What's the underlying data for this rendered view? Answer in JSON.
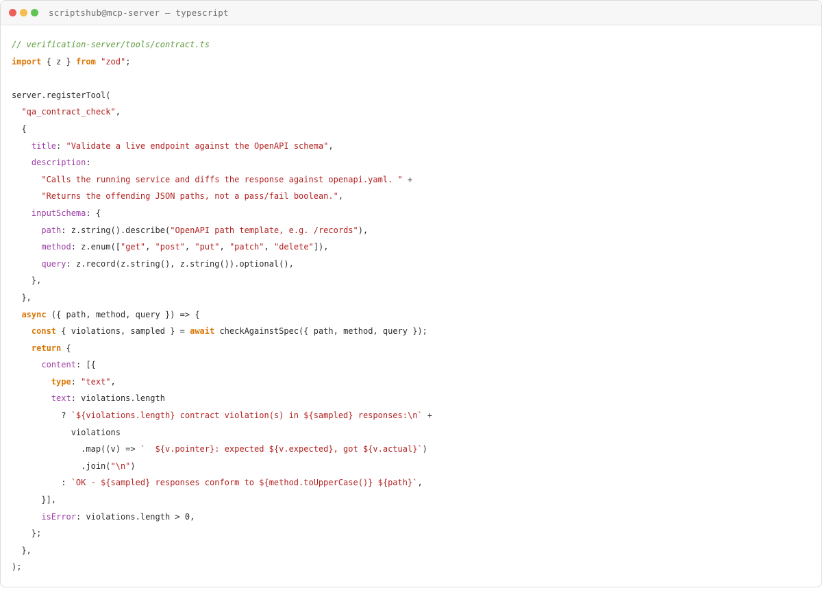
{
  "window": {
    "title": "scriptshub@mcp-server — typescript",
    "controls": [
      {
        "name": "close-button",
        "color": "#ee5f57"
      },
      {
        "name": "minimize-button",
        "color": "#f5bd4f"
      },
      {
        "name": "maximize-button",
        "color": "#5fc453"
      }
    ]
  },
  "colors": {
    "comment": "#5a9a3a",
    "keyword": "#d97706",
    "string": "#b22020",
    "property": "#9c3ea6",
    "text": "#2b2b2b"
  },
  "code_lines": [
    [
      [
        "cmt",
        "// verification-server/tools/contract.ts"
      ]
    ],
    [
      [
        "kw",
        "import"
      ],
      [
        "plain",
        " { z } "
      ],
      [
        "kw",
        "from"
      ],
      [
        "plain",
        " "
      ],
      [
        "str",
        "\"zod\""
      ],
      [
        "plain",
        ";"
      ]
    ],
    [],
    [
      [
        "plain",
        "server.registerTool("
      ]
    ],
    [
      [
        "plain",
        "  "
      ],
      [
        "str",
        "\"qa_contract_check\""
      ],
      [
        "plain",
        ","
      ]
    ],
    [
      [
        "plain",
        "  {"
      ]
    ],
    [
      [
        "plain",
        "    "
      ],
      [
        "prop",
        "title"
      ],
      [
        "plain",
        ": "
      ],
      [
        "str",
        "\"Validate a live endpoint against the OpenAPI schema\""
      ],
      [
        "plain",
        ","
      ]
    ],
    [
      [
        "plain",
        "    "
      ],
      [
        "prop",
        "description"
      ],
      [
        "plain",
        ":"
      ]
    ],
    [
      [
        "plain",
        "      "
      ],
      [
        "str",
        "\"Calls the running service and diffs the response against openapi.yaml. \""
      ],
      [
        "plain",
        " +"
      ]
    ],
    [
      [
        "plain",
        "      "
      ],
      [
        "str",
        "\"Returns the offending JSON paths, not a pass/fail boolean.\""
      ],
      [
        "plain",
        ","
      ]
    ],
    [
      [
        "plain",
        "    "
      ],
      [
        "prop",
        "inputSchema"
      ],
      [
        "plain",
        ": {"
      ]
    ],
    [
      [
        "plain",
        "      "
      ],
      [
        "prop",
        "path"
      ],
      [
        "plain",
        ": z.string().describe("
      ],
      [
        "str",
        "\"OpenAPI path template, e.g. /records\""
      ],
      [
        "plain",
        "),"
      ]
    ],
    [
      [
        "plain",
        "      "
      ],
      [
        "prop",
        "method"
      ],
      [
        "plain",
        ": z.enum(["
      ],
      [
        "str",
        "\"get\""
      ],
      [
        "plain",
        ", "
      ],
      [
        "str",
        "\"post\""
      ],
      [
        "plain",
        ", "
      ],
      [
        "str",
        "\"put\""
      ],
      [
        "plain",
        ", "
      ],
      [
        "str",
        "\"patch\""
      ],
      [
        "plain",
        ", "
      ],
      [
        "str",
        "\"delete\""
      ],
      [
        "plain",
        "]),"
      ]
    ],
    [
      [
        "plain",
        "      "
      ],
      [
        "prop",
        "query"
      ],
      [
        "plain",
        ": z.record(z.string(), z.string()).optional(),"
      ]
    ],
    [
      [
        "plain",
        "    },"
      ]
    ],
    [
      [
        "plain",
        "  },"
      ]
    ],
    [
      [
        "plain",
        "  "
      ],
      [
        "kw",
        "async"
      ],
      [
        "plain",
        " ({ path, method, query }) => {"
      ]
    ],
    [
      [
        "plain",
        "    "
      ],
      [
        "kw",
        "const"
      ],
      [
        "plain",
        " { violations, sampled } = "
      ],
      [
        "kw",
        "await"
      ],
      [
        "plain",
        " checkAgainstSpec({ path, method, query });"
      ]
    ],
    [
      [
        "plain",
        "    "
      ],
      [
        "kw",
        "return"
      ],
      [
        "plain",
        " {"
      ]
    ],
    [
      [
        "plain",
        "      "
      ],
      [
        "prop",
        "content"
      ],
      [
        "plain",
        ": [{"
      ]
    ],
    [
      [
        "plain",
        "        "
      ],
      [
        "kw",
        "type"
      ],
      [
        "plain",
        ": "
      ],
      [
        "str",
        "\"text\""
      ],
      [
        "plain",
        ","
      ]
    ],
    [
      [
        "plain",
        "        "
      ],
      [
        "prop",
        "text"
      ],
      [
        "plain",
        ": violations.length"
      ]
    ],
    [
      [
        "plain",
        "          ? "
      ],
      [
        "str",
        "`${violations.length} contract violation(s) in ${sampled} responses:\\n`"
      ],
      [
        "plain",
        " +"
      ]
    ],
    [
      [
        "plain",
        "            violations"
      ]
    ],
    [
      [
        "plain",
        "              .map((v) => "
      ],
      [
        "str",
        "`  ${v.pointer}: expected ${v.expected}, got ${v.actual}`"
      ],
      [
        "plain",
        ")"
      ]
    ],
    [
      [
        "plain",
        "              .join("
      ],
      [
        "str",
        "\"\\n\""
      ],
      [
        "plain",
        ")"
      ]
    ],
    [
      [
        "plain",
        "          : "
      ],
      [
        "str",
        "`OK - ${sampled} responses conform to ${method.toUpperCase()} ${path}`"
      ],
      [
        "plain",
        ","
      ]
    ],
    [
      [
        "plain",
        "      }],"
      ]
    ],
    [
      [
        "plain",
        "      "
      ],
      [
        "prop",
        "isError"
      ],
      [
        "plain",
        ": violations.length > 0,"
      ]
    ],
    [
      [
        "plain",
        "    };"
      ]
    ],
    [
      [
        "plain",
        "  },"
      ]
    ],
    [
      [
        "plain",
        ");"
      ]
    ]
  ]
}
